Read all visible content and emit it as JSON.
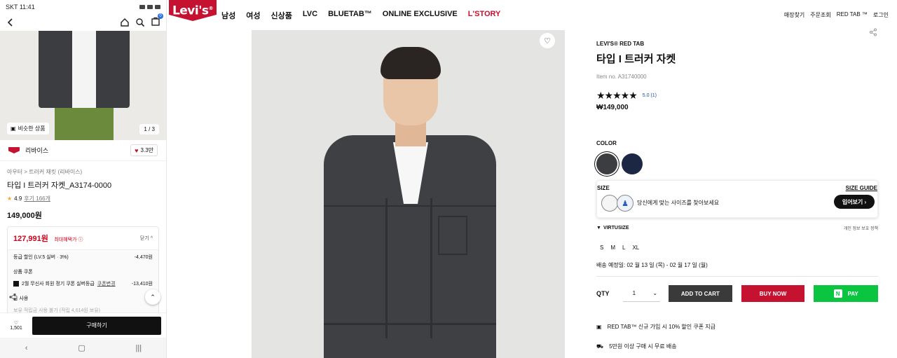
{
  "mobile": {
    "status": {
      "time": "SKT 11:41"
    },
    "cart_count": "0",
    "similar_label": "비슷한 상품",
    "pager": "1 / 3",
    "brand": {
      "name": "리바이스",
      "likes": "3.3만"
    },
    "breadcrumb": "아우터 > 트러커 재킷 (리바이스)",
    "title": "타입 I 트러커 자켓_A3174-0000",
    "rating": {
      "score": "4.9",
      "reviews": "후기 166개"
    },
    "price": "149,000원",
    "benefit": {
      "max_price": "127,991원",
      "max_label": "최대혜택가 ⓘ",
      "close": "닫기 ^",
      "grade_label": "등급 할인 (LV.5 실버 · 3%)",
      "grade_value": "-4,470원",
      "coupon_head": "상품 쿠폰",
      "coupon_label": "2월 무신사 회원 정기 쿠폰 실버등급",
      "coupon_change": "쿠폰변경",
      "coupon_value": "-13,410원",
      "points_head": "금 사용",
      "faded1": "보유 적립금 사용 불가 (적립 4,614원 보유)",
      "faded2": ""
    },
    "favorites": "1,501",
    "buy_label": "구매하기"
  },
  "header": {
    "logo": "Levi's",
    "nav": [
      "남성",
      "여성",
      "신상품",
      "LVC",
      "BLUETAB™",
      "ONLINE EXCLUSIVE",
      "L'STORY"
    ],
    "util": [
      "매장찾기",
      "주문조회",
      "RED TAB ™",
      "로그인"
    ]
  },
  "product": {
    "subbrand": "LEVI'S® RED TAB",
    "title": "타입 I 트러커 자켓",
    "item_no": "Item no. A31740000",
    "stars": "★★★★★",
    "score": "5.0 (1)",
    "price": "₩149,000",
    "color_label": "COLOR",
    "colors": [
      "#3b3d40",
      "#1c2744"
    ],
    "size_label": "SIZE",
    "size_guide": "SIZE GUIDE",
    "size_msg": "당신에게 맞는 사이즈를 찾아보세요",
    "try_on": "입어보기 ›",
    "virtusize": "VIRTUSIZE",
    "privacy": "개인 정보 보호 정책",
    "sizes": [
      "S",
      "M",
      "L",
      "XL"
    ],
    "shipping": "배송 예정일: 02 월 13 일 (목) - 02 월 17 일 (월)",
    "qty_label": "QTY",
    "qty_value": "1",
    "add_to_cart": "ADD TO CART",
    "buy_now": "BUY NOW",
    "pay": "PAY",
    "promo1": "RED TAB™ 신규 가입 시 10% 할인 쿠폰 지급",
    "promo2": "5만원 이상 구매 시 무료 배송"
  },
  "colors": {
    "brand_red": "#c41230",
    "npay_green": "#0bc541",
    "sale_red": "#d0021b"
  }
}
